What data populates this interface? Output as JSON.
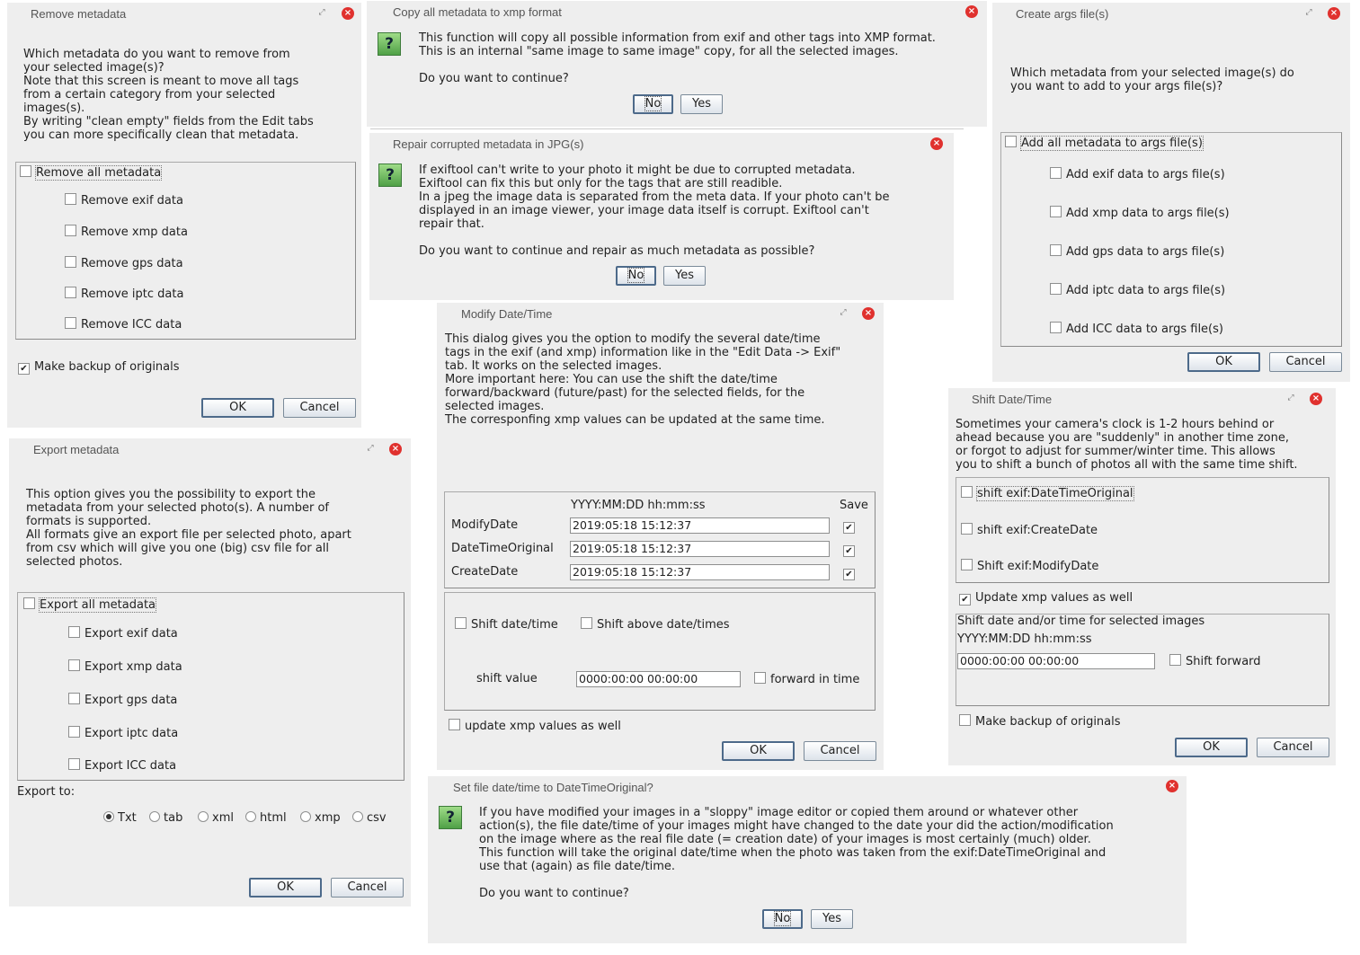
{
  "remove": {
    "title": "Remove metadata",
    "message": "Which metadata do you want to remove from\nyour selected image(s)?\nNote that this screen is meant to move all tags\nfrom a certain category from your selected\nimages(s).\nBy writing \"clean empty\" fields from the Edit tabs\nyou can more specifically clean that metadata.",
    "all": "Remove all metadata",
    "items": [
      "Remove exif data",
      "Remove xmp data",
      "Remove gps data",
      "Remove iptc data",
      "Remove ICC data"
    ],
    "backup": "Make backup of originals",
    "ok": "OK",
    "cancel": "Cancel"
  },
  "copyxmp": {
    "title": "Copy all metadata to xmp format",
    "message": "This function will copy all possible information from exif and other tags into XMP format.\nThis is an internal \"same image to same image\" copy, for all the selected images.\n\nDo you want to continue?",
    "no": "No",
    "yes": "Yes"
  },
  "repair": {
    "title": "Repair corrupted metadata in JPG(s)",
    "message": "If exiftool can't write to your photo it might be due to corrupted metadata.\nExiftool can fix this but only for the tags that are still readible.\nIn a jpeg the image data is separated from the meta data. If your photo can't be\ndisplayed in an image viewer, your image data itself is corrupt. Exiftool can't\nrepair that.\n\nDo you want to continue and repair as much metadata as possible?",
    "no": "No",
    "yes": "Yes"
  },
  "args": {
    "title": "Create args file(s)",
    "message": "Which metadata from your selected image(s) do\nyou want to add to your args file(s)?",
    "all": "Add all metadata to args file(s)",
    "items": [
      "Add exif data to args file(s)",
      "Add xmp data to args file(s)",
      "Add gps data to args file(s)",
      "Add iptc data to args file(s)",
      "Add ICC data to args file(s)"
    ],
    "ok": "OK",
    "cancel": "Cancel"
  },
  "modify": {
    "title": "Modify Date/Time",
    "message": "This dialog gives you the option to modify the several date/time\ntags in the exif (and xmp) information like in the \"Edit Data -> Exif\"\ntab. It works on the selected images.\nMore important here: You can use the shift the date/time\nforward/backward (future/past) for the selected fields, for the\nselected images.\nThe corresponfing xmp values can be updated at the same time.",
    "format_header": "YYYY:MM:DD hh:mm:ss",
    "save_header": "Save",
    "rows": [
      {
        "label": "ModifyDate",
        "value": "2019:05:18 15:12:37"
      },
      {
        "label": "DateTimeOriginal",
        "value": "2019:05:18 15:12:37"
      },
      {
        "label": "CreateDate",
        "value": "2019:05:18 15:12:37"
      }
    ],
    "shift_date": "Shift date/time",
    "shift_above": "Shift above date/times",
    "shift_value_label": "shift value",
    "shift_value": "0000:00:00 00:00:00",
    "forward": "forward in time",
    "update_xmp": "update xmp values as well",
    "ok": "OK",
    "cancel": "Cancel"
  },
  "shift": {
    "title": "Shift Date/Time",
    "message": "Sometimes your camera's clock is 1-2 hours behind or\nahead because you are \"suddenly\" in another time zone,\nor forgot to adjust for summer/winter time. This allows\nyou to shift a bunch of photos all with the same time shift.",
    "items": [
      "shift exif:DateTimeOriginal",
      "shift exif:CreateDate",
      "Shift exif:ModifyDate"
    ],
    "update_xmp": "Update xmp values as well",
    "group_title": "Shift date and/or time for selected images",
    "format": "YYYY:MM:DD hh:mm:ss",
    "value": "0000:00:00 00:00:00",
    "forward": "Shift forward",
    "backup": "Make backup of originals",
    "ok": "OK",
    "cancel": "Cancel"
  },
  "export": {
    "title": "Export metadata",
    "message": "This option gives you the possibility to export the\nmetadata from your selected photo(s). A number of\nformats is supported.\nAll formats give an export file per selected photo, apart\nfrom csv which will give you one (big) csv file for all\nselected photos.",
    "all": "Export all metadata",
    "items": [
      "Export exif data",
      "Export xmp data",
      "Export gps data",
      "Export iptc data",
      "Export ICC data"
    ],
    "export_to": "Export to:",
    "formats": [
      "Txt",
      "tab",
      "xml",
      "html",
      "xmp",
      "csv"
    ],
    "ok": "OK",
    "cancel": "Cancel"
  },
  "setfile": {
    "title": "Set file date/time to DateTimeOriginal?",
    "message": "If you have modified your images in a \"sloppy\" image editor or copied them around or whatever other\naction(s), the file date/time of your images might have changed to the date your did the action/modification\non the image where as the real file date (= creation date) of your images is most certainly (much) older.\nThis function will take the original date/time when the photo was taken from the exif:DateTimeOriginal and\nuse that (again) as file date/time.\n\nDo you want to continue?",
    "no": "No",
    "yes": "Yes"
  },
  "icons": {
    "question": "?",
    "close": "×",
    "restore": "⤢",
    "check": "✔"
  }
}
